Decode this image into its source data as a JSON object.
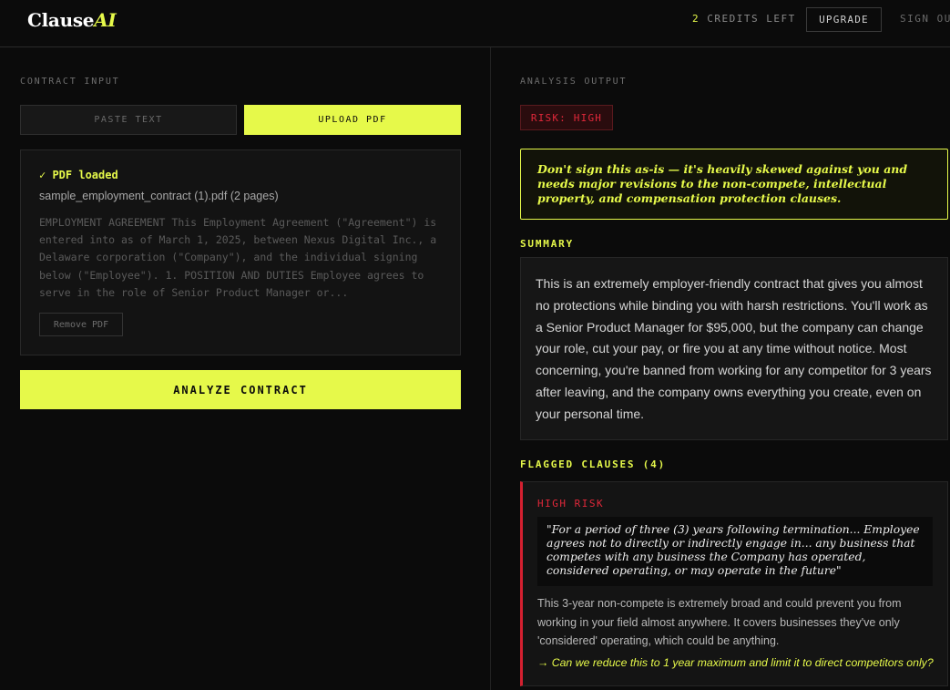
{
  "header": {
    "logo_main": "Clause",
    "logo_accent": "AI",
    "credits_count": "2",
    "credits_label": "CREDITS LEFT",
    "upgrade_label": "UPGRADE",
    "signout_label": "SIGN OUT"
  },
  "input_panel": {
    "section_label": "CONTRACT INPUT",
    "tabs": [
      {
        "label": "PASTE TEXT",
        "active": false
      },
      {
        "label": "UPLOAD PDF",
        "active": true
      }
    ],
    "pdf": {
      "status": "✓ PDF loaded",
      "filename": "sample_employment_contract (1).pdf (2 pages)",
      "preview": "EMPLOYMENT AGREEMENT This Employment Agreement (\"Agreement\") is entered into as of March 1, 2025, between Nexus Digital Inc., a Delaware corporation (\"Company\"), and the individual signing below (\"Employee\"). 1. POSITION AND DUTIES Employee agrees to serve in the role of Senior Product Manager or...",
      "remove_label": "Remove PDF"
    },
    "analyze_label": "ANALYZE CONTRACT"
  },
  "output_panel": {
    "section_label": "ANALYSIS OUTPUT",
    "risk_badge": "RISK: HIGH",
    "verdict": "Don't sign this as-is — it's heavily skewed against you and needs major revisions to the non-compete, intellectual property, and compensation protection clauses.",
    "summary_label": "SUMMARY",
    "summary": "This is an extremely employer-friendly contract that gives you almost no protections while binding you with harsh restrictions. You'll work as a Senior Product Manager for $95,000, but the company can change your role, cut your pay, or fire you at any time without notice. Most concerning, you're banned from working for any competitor for 3 years after leaving, and the company owns everything you create, even on your personal time.",
    "flagged_label": "FLAGGED CLAUSES (4)",
    "clauses": [
      {
        "risk": "HIGH RISK",
        "quote": "\"For a period of three (3) years following termination... Employee agrees not to directly or indirectly engage in... any business that competes with any business the Company has operated, considered operating, or may operate in the future\"",
        "explanation": "This 3-year non-compete is extremely broad and could prevent you from working in your field almost anywhere. It covers businesses they've only 'considered' operating, which could be anything.",
        "suggestion": "→ Can we reduce this to 1 year maximum and limit it to direct competitors only?"
      }
    ]
  },
  "colors": {
    "accent": "#e6f94a",
    "risk_red": "#e0283a",
    "background": "#0b0b0b"
  }
}
